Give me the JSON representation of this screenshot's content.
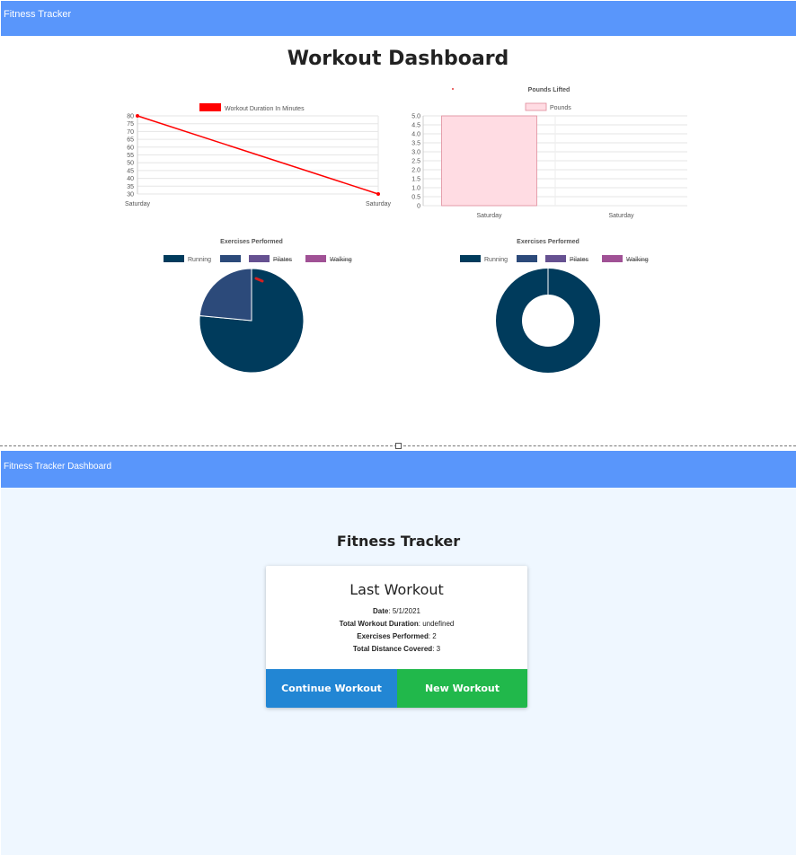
{
  "top_nav": {
    "brand": "Fitness Tracker"
  },
  "dashboard": {
    "title": "Workout Dashboard"
  },
  "chart_data": [
    {
      "type": "line",
      "title": "",
      "legend": "Workout Duration In Minutes",
      "legend_position": "top",
      "color": "#ff0000",
      "categories": [
        "Saturday",
        "Saturday"
      ],
      "values": [
        80,
        30
      ],
      "ylim": [
        30,
        80
      ],
      "yticks": [
        "80",
        "75",
        "70",
        "65",
        "60",
        "55",
        "50",
        "45",
        "40",
        "35",
        "30"
      ],
      "grid": true
    },
    {
      "type": "bar",
      "title": "Pounds Lifted",
      "legend": "Pounds",
      "legend_position": "top",
      "color": "#ffdce3",
      "categories": [
        "Saturday",
        "Saturday"
      ],
      "values": [
        5,
        0
      ],
      "ylim": [
        0,
        5
      ],
      "yticks": [
        "5.0",
        "4.5",
        "4.0",
        "3.5",
        "3.0",
        "2.5",
        "2.0",
        "1.5",
        "1.0",
        "0.5",
        "0"
      ],
      "grid": true
    },
    {
      "type": "pie",
      "title": "Exercises Performed",
      "legend_position": "top",
      "legend": [
        {
          "label": "Running",
          "color": "#003b5c",
          "hidden": false
        },
        {
          "label": "",
          "color": "#2c4a7a",
          "hidden": false
        },
        {
          "label": "Pilates",
          "color": "#665191",
          "hidden": true
        },
        {
          "label": "Walking",
          "color": "#a05195",
          "hidden": true
        }
      ],
      "slices": [
        {
          "color": "#003b5c",
          "fraction": 0.765
        },
        {
          "color": "#2c4a7a",
          "fraction": 0.235
        }
      ]
    },
    {
      "type": "pie",
      "title": "Exercises Performed",
      "legend_position": "top",
      "legend": [
        {
          "label": "Running",
          "color": "#003b5c",
          "hidden": false
        },
        {
          "label": "",
          "color": "#2c4a7a",
          "hidden": false
        },
        {
          "label": "Pilates",
          "color": "#665191",
          "hidden": true
        },
        {
          "label": "Walking",
          "color": "#a05195",
          "hidden": true
        }
      ],
      "slices": [
        {
          "color": "#003b5c",
          "fraction": 1
        }
      ],
      "doughnut": true
    }
  ],
  "second_nav": {
    "brand": "Fitness Tracker Dashboard"
  },
  "tracker": {
    "title": "Fitness Tracker",
    "card": {
      "heading": "Last Workout",
      "date_label": "Date",
      "date_value": ": 5/1/2021",
      "duration_label": "Total Workout Duration",
      "duration_value": ": undefined",
      "exercises_label": "Exercises Performed",
      "exercises_value": ": 2",
      "distance_label": "Total Distance Covered",
      "distance_value": ": 3",
      "continue_label": "Continue Workout",
      "new_label": "New Workout"
    }
  },
  "colors": {
    "nav": "#5996fb",
    "continue": "#2286d4",
    "new": "#21b84b",
    "panel_bg": "#eff7ff"
  }
}
